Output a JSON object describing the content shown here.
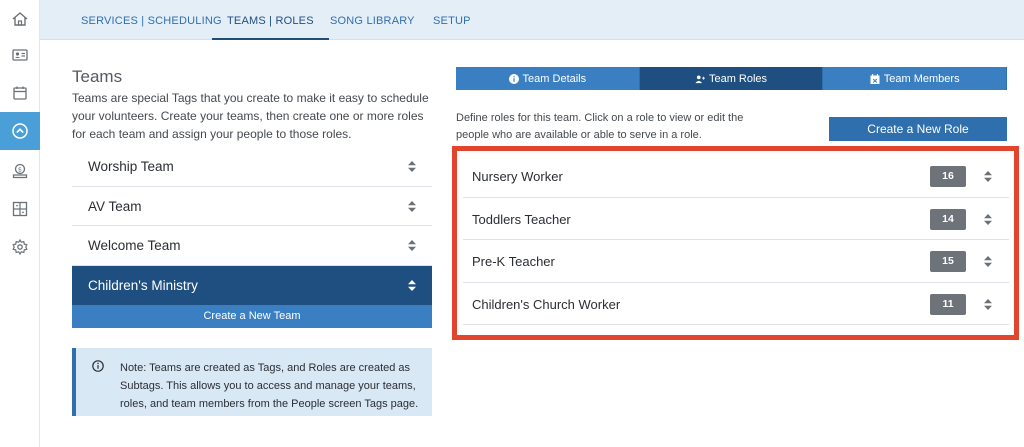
{
  "sidebar": {
    "items": [
      {
        "icon": "home-icon",
        "active": false
      },
      {
        "icon": "contact-card-icon",
        "active": false
      },
      {
        "icon": "calendar-icon",
        "active": false
      },
      {
        "icon": "chevron-up-circle-icon",
        "active": true
      },
      {
        "icon": "donation-icon",
        "active": false
      },
      {
        "icon": "dashboard-grid-icon",
        "active": false
      },
      {
        "icon": "gear-icon",
        "active": false
      }
    ]
  },
  "topnav": {
    "tabs": [
      "SERVICES | SCHEDULING",
      "TEAMS | ROLES",
      "SONG LIBRARY",
      "SETUP"
    ],
    "active_tab": "TEAMS | ROLES"
  },
  "teams": {
    "title": "Teams",
    "description": "Teams are special Tags that you create to make it easy to schedule your volunteers. Create your teams, then create one or more roles for each team and assign your people to those roles.",
    "list": [
      {
        "name": "Worship Team"
      },
      {
        "name": "AV Team"
      },
      {
        "name": "Welcome Team"
      },
      {
        "name": "Children's Ministry"
      }
    ],
    "selected": "Children's Ministry",
    "create_button": "Create a New Team",
    "note": "Note: Teams are created as Tags, and Roles are created as Subtags. This allows you to access and manage your teams, roles, and team members from the People screen Tags page."
  },
  "team_tabs": {
    "items": [
      {
        "label": "Team Details",
        "icon": "info-circle-icon"
      },
      {
        "label": "Team Roles",
        "icon": "users-icon"
      },
      {
        "label": "Team Members",
        "icon": "calendar-x-icon"
      }
    ],
    "active": "Team Roles"
  },
  "roles": {
    "description": "Define roles for this team. Click on a role to view or edit the people who are available or able to serve in a role.",
    "create_button": "Create a New Role",
    "list": [
      {
        "name": "Nursery Worker",
        "count": "16"
      },
      {
        "name": "Toddlers Teacher",
        "count": "14"
      },
      {
        "name": "Pre-K Teacher",
        "count": "15"
      },
      {
        "name": "Children's Church Worker",
        "count": "11"
      }
    ]
  },
  "colors": {
    "accent": "#3a7fc2",
    "dark_accent": "#1f4f80",
    "highlight_border": "#e2442d",
    "sidebar_active": "#4a9fd8"
  }
}
